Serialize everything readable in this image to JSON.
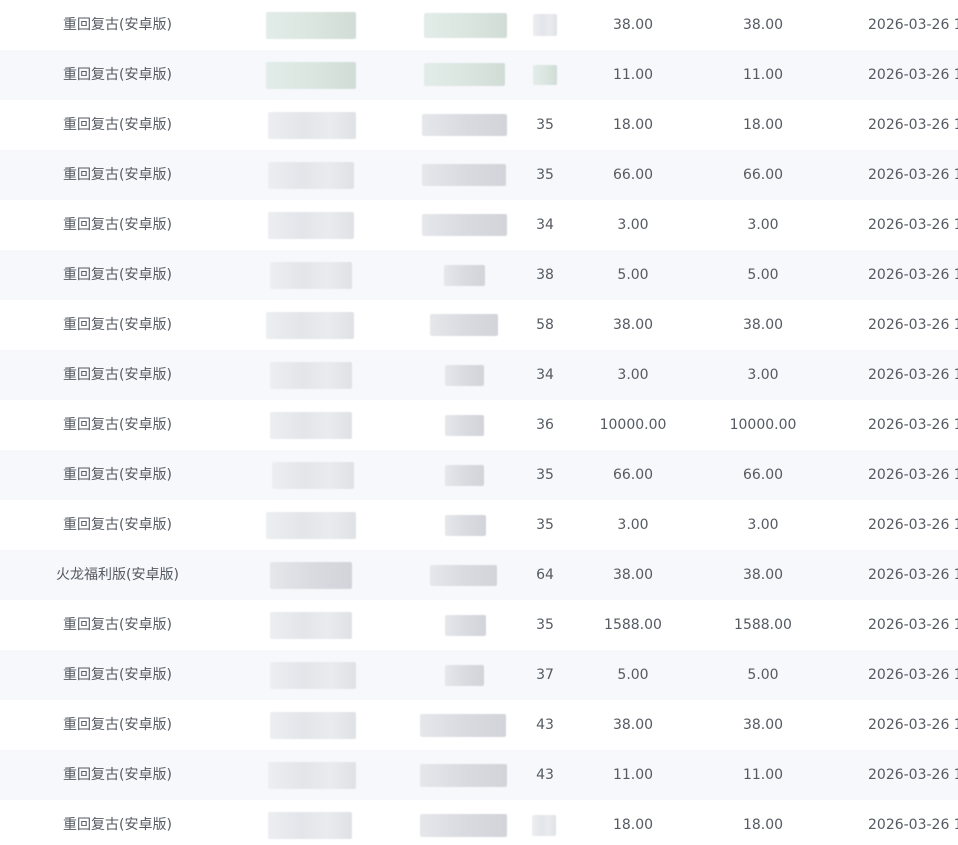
{
  "rows": [
    {
      "game": "重回复古(安卓版)",
      "level": "",
      "amount": "38.00",
      "paid": "38.00",
      "date": "2026-03-26 1"
    },
    {
      "game": "重回复古(安卓版)",
      "level": "",
      "amount": "11.00",
      "paid": "11.00",
      "date": "2026-03-26 1"
    },
    {
      "game": "重回复古(安卓版)",
      "level": "35",
      "amount": "18.00",
      "paid": "18.00",
      "date": "2026-03-26 1"
    },
    {
      "game": "重回复古(安卓版)",
      "level": "35",
      "amount": "66.00",
      "paid": "66.00",
      "date": "2026-03-26 1"
    },
    {
      "game": "重回复古(安卓版)",
      "level": "34",
      "amount": "3.00",
      "paid": "3.00",
      "date": "2026-03-26 1"
    },
    {
      "game": "重回复古(安卓版)",
      "level": "38",
      "amount": "5.00",
      "paid": "5.00",
      "date": "2026-03-26 1"
    },
    {
      "game": "重回复古(安卓版)",
      "level": "58",
      "amount": "38.00",
      "paid": "38.00",
      "date": "2026-03-26 1"
    },
    {
      "game": "重回复古(安卓版)",
      "level": "34",
      "amount": "3.00",
      "paid": "3.00",
      "date": "2026-03-26 1"
    },
    {
      "game": "重回复古(安卓版)",
      "level": "36",
      "amount": "10000.00",
      "paid": "10000.00",
      "date": "2026-03-26 1"
    },
    {
      "game": "重回复古(安卓版)",
      "level": "35",
      "amount": "66.00",
      "paid": "66.00",
      "date": "2026-03-26 1"
    },
    {
      "game": "重回复古(安卓版)",
      "level": "35",
      "amount": "3.00",
      "paid": "3.00",
      "date": "2026-03-26 1"
    },
    {
      "game": "火龙福利版(安卓版)",
      "level": "64",
      "amount": "38.00",
      "paid": "38.00",
      "date": "2026-03-26 1"
    },
    {
      "game": "重回复古(安卓版)",
      "level": "35",
      "amount": "1588.00",
      "paid": "1588.00",
      "date": "2026-03-26 1"
    },
    {
      "game": "重回复古(安卓版)",
      "level": "37",
      "amount": "5.00",
      "paid": "5.00",
      "date": "2026-03-26 1"
    },
    {
      "game": "重回复古(安卓版)",
      "level": "43",
      "amount": "38.00",
      "paid": "38.00",
      "date": "2026-03-26 1"
    },
    {
      "game": "重回复古(安卓版)",
      "level": "43",
      "amount": "11.00",
      "paid": "11.00",
      "date": "2026-03-26 1"
    },
    {
      "game": "重回复古(安卓版)",
      "level": "",
      "amount": "18.00",
      "paid": "18.00",
      "date": "2026-03-26 1"
    }
  ]
}
